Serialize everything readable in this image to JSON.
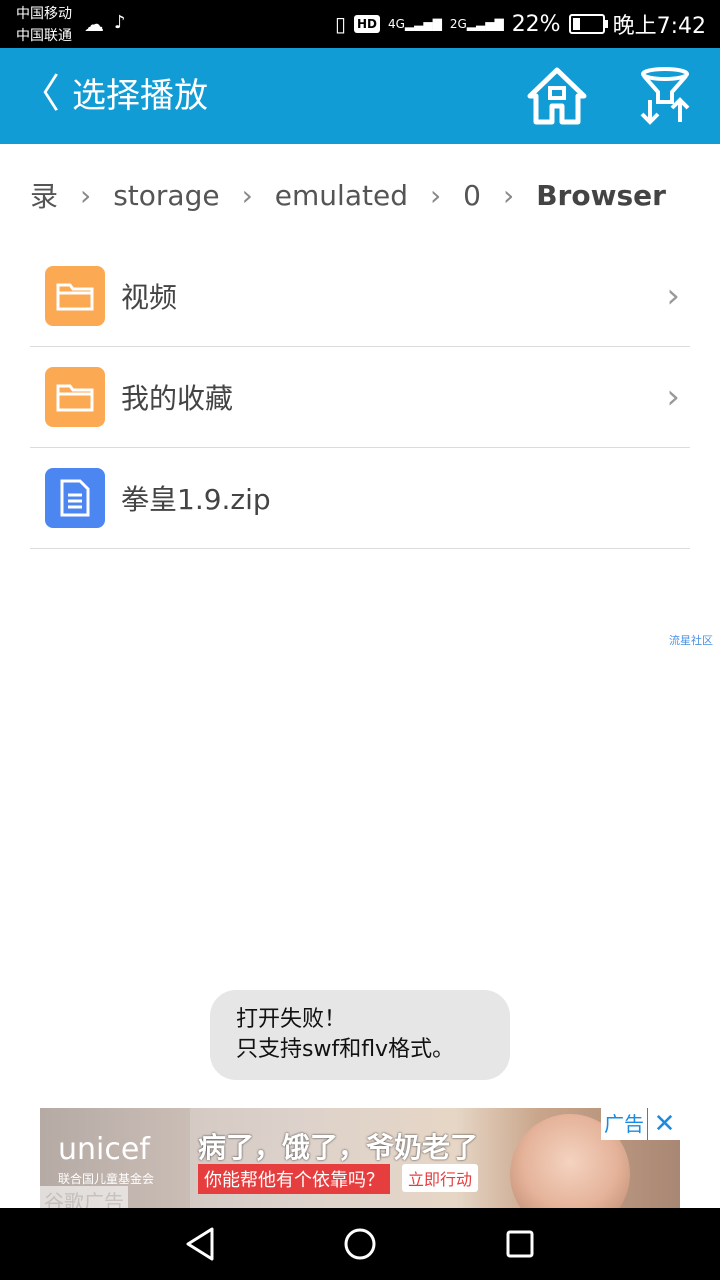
{
  "status_bar": {
    "carrier1": "中国移动",
    "carrier2": "中国联通",
    "net1": "4G",
    "net2": "2G",
    "hd": "HD",
    "battery": "22%",
    "battery_level": 0.22,
    "time": "晚上7:42"
  },
  "app_bar": {
    "back_glyph": "〈",
    "title": "选择播放",
    "icons": [
      "home-icon",
      "filter-sort-icon"
    ]
  },
  "breadcrumb": [
    "录",
    "storage",
    "emulated",
    "0",
    "Browser"
  ],
  "files": [
    {
      "name": "视频",
      "type": "folder",
      "icon": "folder-icon"
    },
    {
      "name": "我的收藏",
      "type": "folder",
      "icon": "folder-icon"
    },
    {
      "name": "拳皇1.9.zip",
      "type": "file",
      "icon": "document-icon"
    }
  ],
  "watermark": "流星社区",
  "toast": {
    "line1": "打开失败！",
    "line2": "只支持swf和flv格式。"
  },
  "ad": {
    "brand": "unicef",
    "brand_sub": "联合国儿童基金会",
    "headline": "病了，饿了，爷奶老了",
    "subline": "你能帮他有个依靠吗？",
    "cta": "立即行动",
    "label": "广告",
    "close": "✕",
    "google_label": "谷歌广告"
  },
  "colors": {
    "app_bar": "#119CD6",
    "folder": "#FBA953",
    "doc": "#4C86F0",
    "toast_bg": "#E6E6E6"
  }
}
